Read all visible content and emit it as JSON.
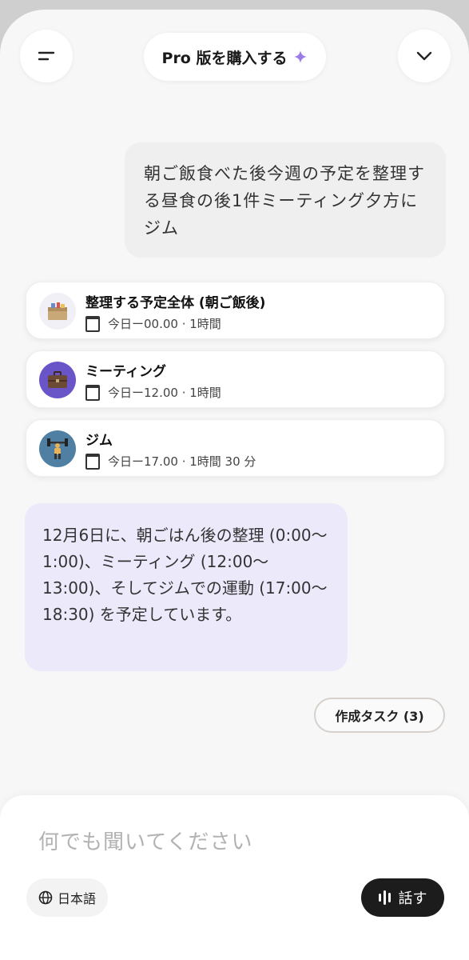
{
  "header": {
    "pro_label": "Pro 版を購入する",
    "menu_icon": "menu-icon",
    "chevron_icon": "chevron-down-icon",
    "sparkle_icon": "sparkle-icon"
  },
  "user_message": {
    "text": "朝ご飯食べた後今週の予定を整理する昼食の後1件ミーティング夕方にジム"
  },
  "tasks": [
    {
      "title": "整理する予定全体 (朝ご飯後)",
      "time": "今日ー00.00 · 1時間",
      "icon": "boxes-icon"
    },
    {
      "title": "ミーティング",
      "time": "今日ー12.00 · 1時間",
      "icon": "briefcase-icon"
    },
    {
      "title": "ジム",
      "time": "今日ー17.00 · 1時間 30 分",
      "icon": "weightlifter-icon"
    }
  ],
  "ai_message": {
    "text": "12月6日に、朝ごはん後の整理 (0:00〜1:00)、ミーティング (12:00〜13:00)、そしてジムでの運動 (17:00〜18:30) を予定しています。"
  },
  "created_tasks_button": "作成タスク (3)",
  "composer": {
    "placeholder": "何でも聞いてください",
    "language_label": "日本語",
    "speak_label": "話す",
    "globe_icon": "globe-icon",
    "waveform_icon": "waveform-icon"
  },
  "colors": {
    "accent": "#9b7be8",
    "ai_bubble": "#ece9fb",
    "user_bubble": "#efefef",
    "speak_button": "#1c1c1c"
  }
}
